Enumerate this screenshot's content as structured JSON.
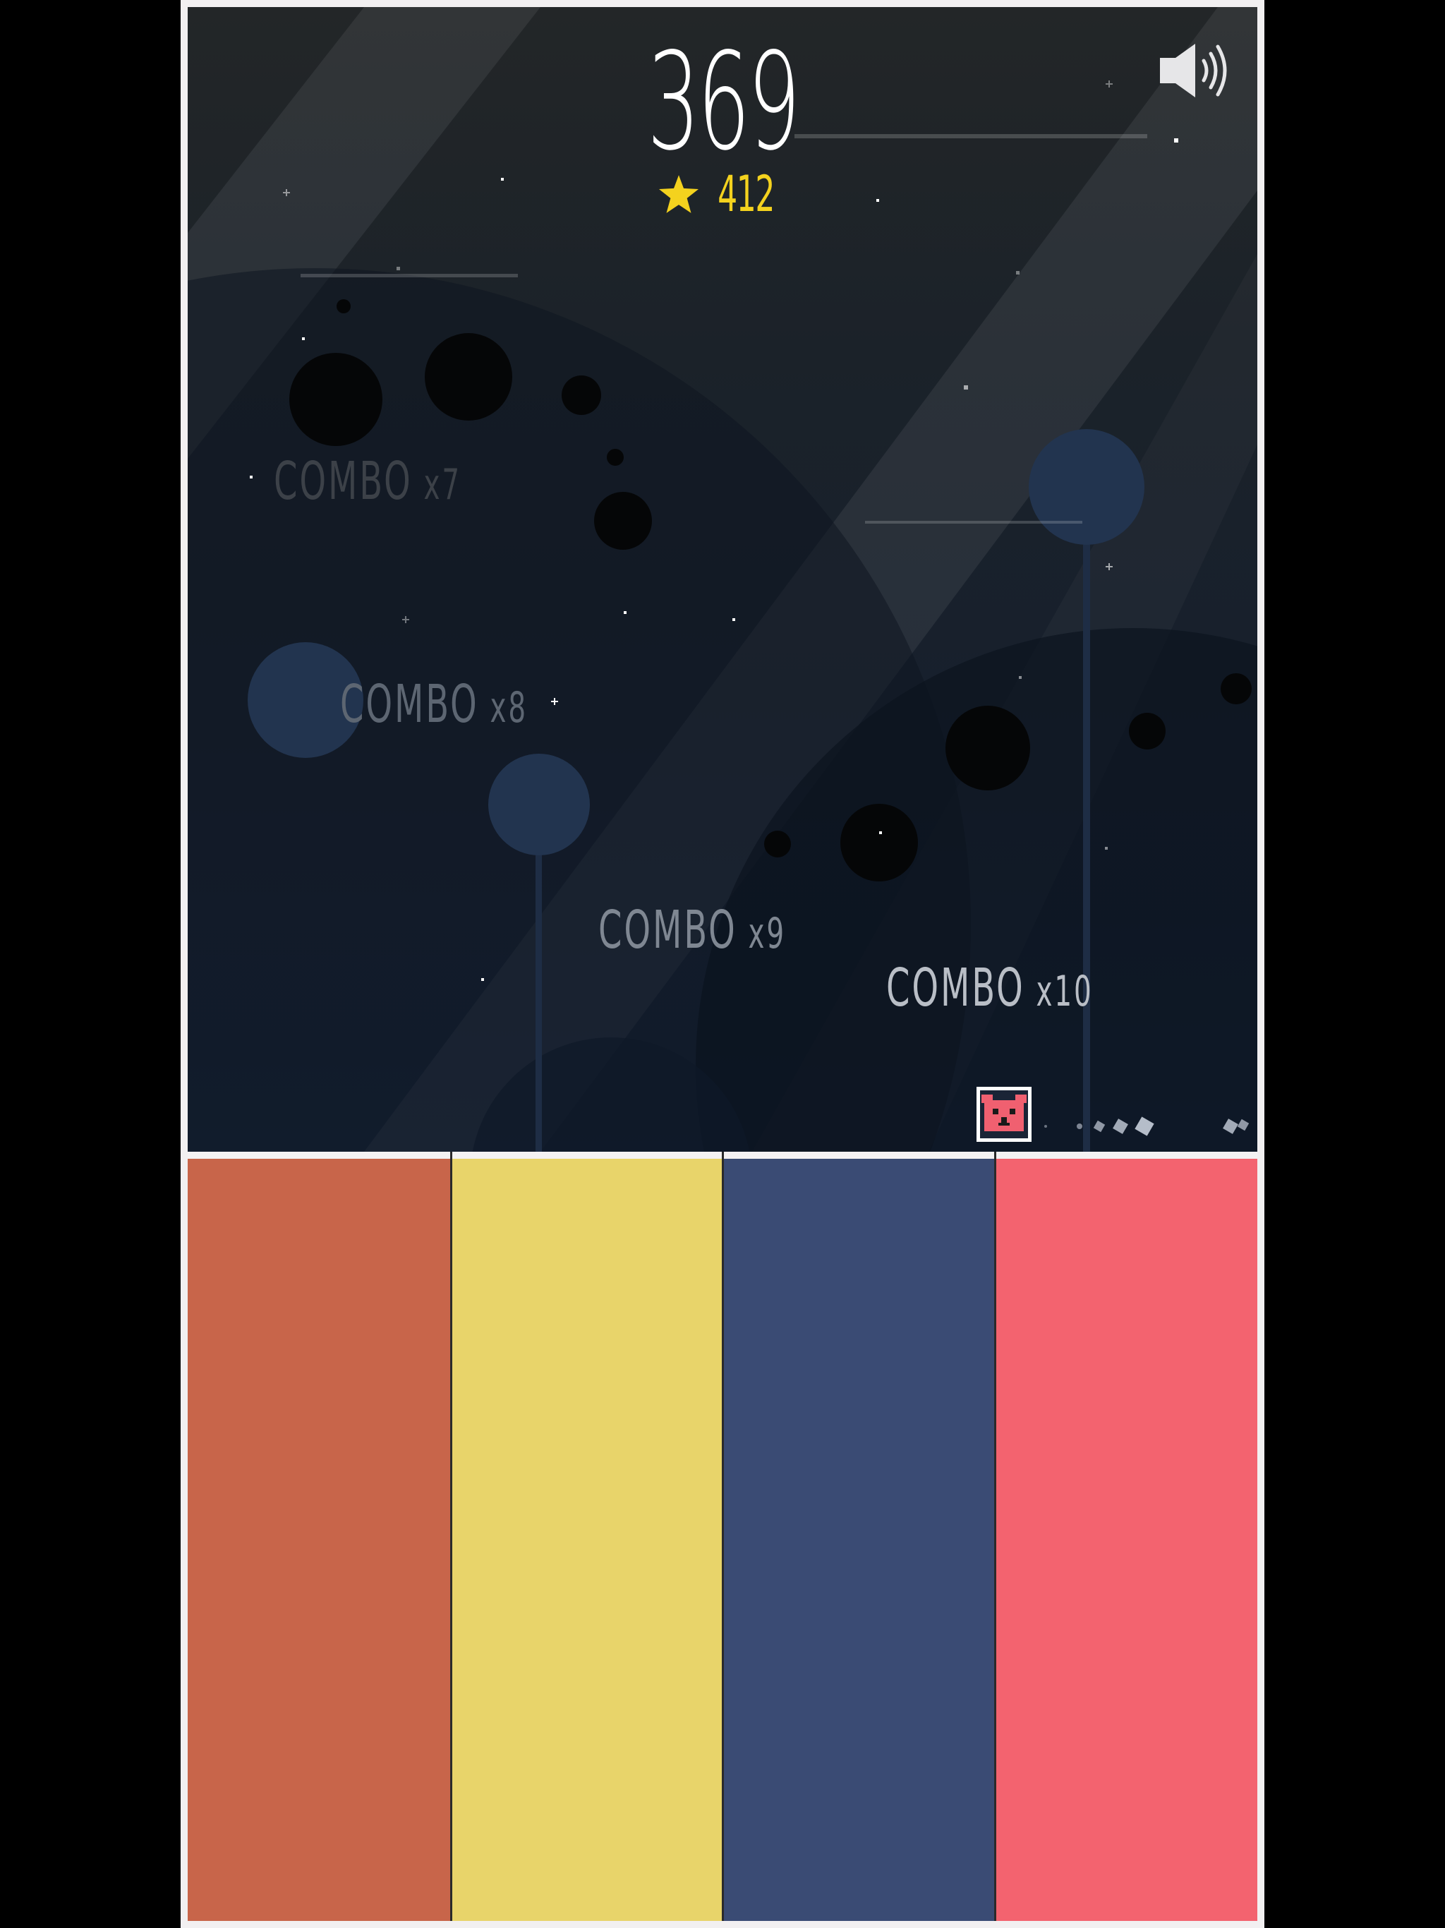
{
  "score": "369",
  "best_score": "412",
  "combos": [
    {
      "label": "COMBO",
      "multiplier": "x7"
    },
    {
      "label": "COMBO",
      "multiplier": "x8"
    },
    {
      "label": "COMBO",
      "multiplier": "x9"
    },
    {
      "label": "COMBO",
      "multiplier": "x10"
    }
  ],
  "icons": {
    "sound": "speaker-on-icon",
    "best": "star-icon",
    "player": "bear-face-icon"
  },
  "colors": {
    "pad_1": "#c8654a",
    "pad_2": "#e8d46a",
    "pad_3": "#3a4b74",
    "pad_4": "#f3636f",
    "best": "#f4d21e",
    "player": "#f06070"
  }
}
